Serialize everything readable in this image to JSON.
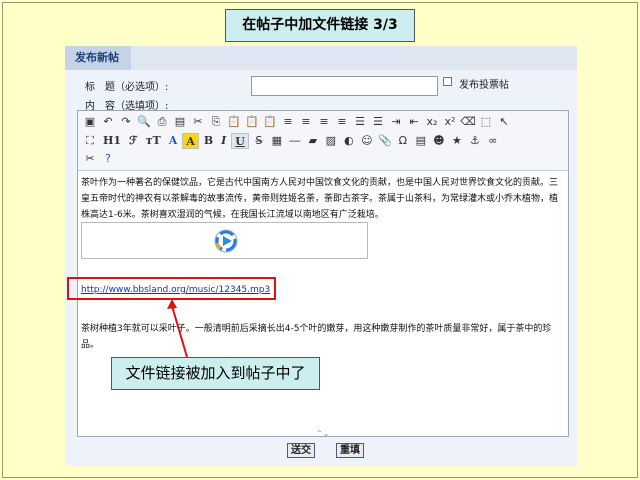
{
  "slide": {
    "title": "在帖子中加文件链接 3/3",
    "callout": "文件链接被加入到帖子中了"
  },
  "form": {
    "header": "发布新帖",
    "title_label": "标　题（必选项）:",
    "content_label": "内　容（选填项）:",
    "title_value": "",
    "poll_label": "发布投票帖"
  },
  "toolbar": {
    "row2_texts": [
      "H1",
      "ℱ",
      "тT",
      "A",
      "A",
      "B",
      "I",
      "U"
    ]
  },
  "editor": {
    "paragraph1": "茶叶作为一种著名的保健饮品，它是古代中国南方人民对中国饮食文化的贡献，也是中国人民对世界饮食文化的贡献。三皇五帝时代的神农有以茶解毒的故事流传，黄帝则姓姬名荼，荼即古茶字。茶属于山茶科，为常绿灌木或小乔木植物，植株高达1-6米。茶树喜欢湿润的气候，在我国长江流域以南地区有广泛栽培。",
    "link": "http://www.bbsland.org/music/12345.mp3",
    "paragraph2": "茶树种植3年就可以采叶子。一般清明前后采摘长出4-5个叶的嫩芽，用这种嫩芽制作的茶叶质量非常好，属于茶中的珍品。"
  },
  "buttons": {
    "submit": "送交",
    "reset": "重填"
  },
  "colors": {
    "background": "#ffffc8",
    "callout_bg": "#cdeeee",
    "highlight": "#e01010",
    "link": "#1a33aa"
  }
}
